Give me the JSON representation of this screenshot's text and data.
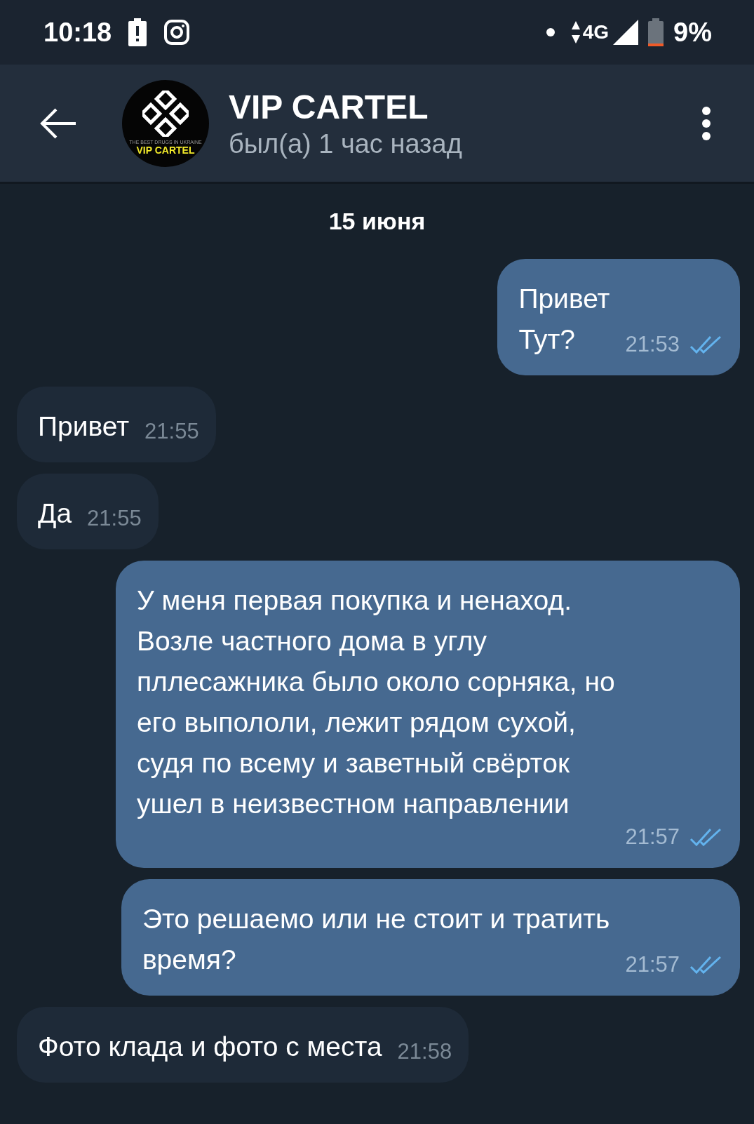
{
  "status_bar": {
    "time": "10:18",
    "battery": "9%",
    "network": "4G"
  },
  "header": {
    "title": "VIP CARTEL",
    "subtitle": "был(а) 1 час назад",
    "avatar": {
      "tagline": "THE BEST DRUGS IN UKRAINE",
      "label": "VIP CARTEL"
    }
  },
  "date_separator": "15 июня",
  "messages": [
    {
      "kind": "outgoing",
      "text": "Привет\nТут?",
      "time": "21:53"
    },
    {
      "kind": "incoming",
      "text": "Привет",
      "time": "21:55"
    },
    {
      "kind": "incoming",
      "text": "Да",
      "time": "21:55"
    },
    {
      "kind": "outgoing",
      "text": "У меня первая покупка и ненаход.\nВозле частного дома в углу\nпллесажника было около сорняка, но\nего выпололи, лежит рядом сухой,\nсудя по всему и заветный свёрток\nушел в неизвестном направлении",
      "time": "21:57"
    },
    {
      "kind": "outgoing",
      "text": "Это решаемо или не стоит и тратить\nвремя?",
      "time": "21:57"
    },
    {
      "kind": "incoming",
      "text": "Фото клада и фото с места",
      "time": "21:58"
    }
  ]
}
